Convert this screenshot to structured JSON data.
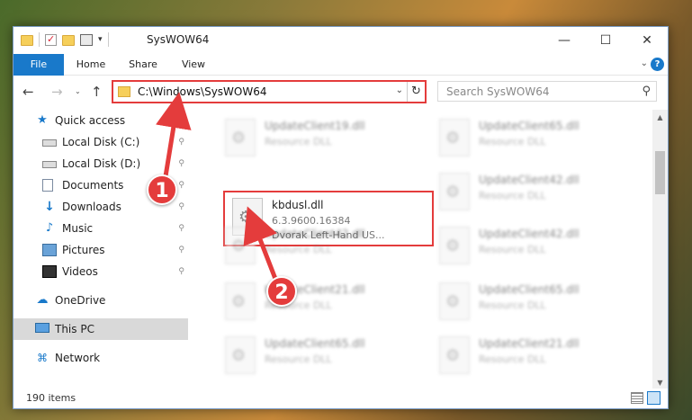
{
  "window": {
    "title": "SysWOW64",
    "controls": {
      "minimize": "—",
      "maximize": "☐",
      "close": "✕"
    }
  },
  "ribbon": {
    "tabs": [
      "File",
      "Home",
      "Share",
      "View"
    ],
    "expand": "⌄",
    "help": "?"
  },
  "nav": {
    "back": "←",
    "forward": "→",
    "recent": "⌄",
    "up": "↑"
  },
  "address": {
    "path": "C:\\Windows\\SysWOW64",
    "dropdown": "⌄",
    "refresh": "↻"
  },
  "search": {
    "placeholder": "Search SysWOW64",
    "icon": "search-icon"
  },
  "navpane": {
    "items": [
      {
        "label": "Quick access",
        "icon": "star-icon",
        "pinned": false
      },
      {
        "label": "Local Disk (C:)",
        "icon": "disk-icon",
        "pinned": true
      },
      {
        "label": "Local Disk (D:)",
        "icon": "disk-icon",
        "pinned": true
      },
      {
        "label": "Documents",
        "icon": "documents-icon",
        "pinned": true
      },
      {
        "label": "Downloads",
        "icon": "downloads-icon",
        "pinned": true
      },
      {
        "label": "Music",
        "icon": "music-icon",
        "pinned": true
      },
      {
        "label": "Pictures",
        "icon": "pictures-icon",
        "pinned": true
      },
      {
        "label": "Videos",
        "icon": "videos-icon",
        "pinned": true
      },
      {
        "label": "OneDrive",
        "icon": "onedrive-icon",
        "pinned": false
      },
      {
        "label": "This PC",
        "icon": "this-pc-icon",
        "pinned": false,
        "selected": true
      },
      {
        "label": "Network",
        "icon": "network-icon",
        "pinned": false
      }
    ],
    "pin_glyph": "📌"
  },
  "files": {
    "left_column": [
      {
        "name": "UpdateClient19.dll",
        "type": "Resource DLL",
        "blurred": true
      },
      {
        "name": "kbdusl.dll",
        "version": "6.3.9600.16384",
        "description": "Dvorak Left-Hand US...",
        "highlighted": true
      },
      {
        "name": "UpdateClient42.dll",
        "type": "Resource DLL",
        "blurred": true
      },
      {
        "name": "UpdateClient21.dll",
        "type": "Resource DLL",
        "blurred": true
      },
      {
        "name": "UpdateClient65.dll",
        "type": "Resource DLL",
        "blurred": true
      }
    ],
    "right_column": [
      {
        "name": "UpdateClient65.dll",
        "type": "Resource DLL",
        "blurred": true
      },
      {
        "name": "UpdateClient42.dll",
        "type": "Resource DLL",
        "blurred": true
      },
      {
        "name": "UpdateClient42.dll",
        "type": "Resource DLL",
        "blurred": true
      },
      {
        "name": "UpdateClient65.dll",
        "type": "Resource DLL",
        "blurred": true
      },
      {
        "name": "UpdateClient21.dll",
        "type": "Resource DLL",
        "blurred": true
      }
    ]
  },
  "status": {
    "item_count": "190 items"
  },
  "annotations": {
    "callout_1": "1",
    "callout_2": "2",
    "color": "#e43c3c"
  },
  "colors": {
    "accent": "#1979ca",
    "highlight_border": "#e43c3c"
  }
}
